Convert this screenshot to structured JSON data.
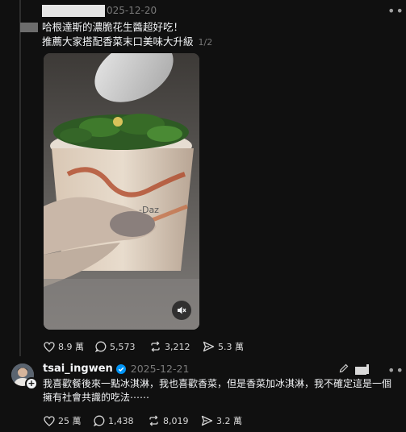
{
  "post1": {
    "date": "025-12-20",
    "text_line1": "哈根達斯的濃脆花生醬超好吃！",
    "text_line2": "推薦大家搭配香菜末口美味大升級",
    "media_counter": "1/2",
    "stats": {
      "likes": "8.9 萬",
      "comments": "5,573",
      "reposts": "3,212",
      "shares": "5.3 萬"
    }
  },
  "reply": {
    "username": "tsai_ingwen",
    "date": "2025-12-21",
    "text_line1": "我喜歡餐後來一點冰淇淋，我也喜歡香菜，但是香菜加冰淇淋，我不確定這是一個",
    "text_line2": "擁有社會共識的吃法⋯⋯",
    "stats": {
      "likes": "25 萬",
      "comments": "1,438",
      "reposts": "8,019",
      "shares": "3.2 萬"
    }
  },
  "colors": {
    "background": "#101010",
    "text": "#f3f5f7",
    "secondary": "#7a7a7a",
    "verified": "#0095f6"
  }
}
